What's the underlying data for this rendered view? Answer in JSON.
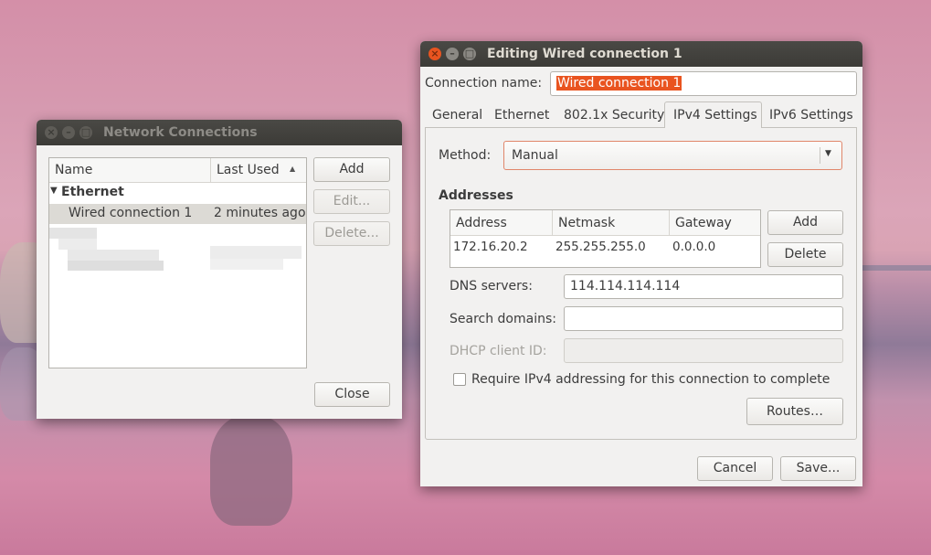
{
  "network_connections": {
    "title": "Network Connections",
    "columns": {
      "name": "Name",
      "last_used": "Last Used",
      "sort_icon": "sort-ascending-icon"
    },
    "group": {
      "label": "Ethernet",
      "icon": "expander-open-icon"
    },
    "selected_row": {
      "name": "Wired connection 1",
      "last_used": "2 minutes ago"
    },
    "buttons": {
      "add": "Add",
      "edit": "Edit...",
      "delete": "Delete...",
      "close": "Close"
    }
  },
  "editor": {
    "title": "Editing Wired connection 1",
    "connection_name_label": "Connection name:",
    "connection_name_value": "Wired connection 1",
    "tabs": [
      "General",
      "Ethernet",
      "802.1x Security",
      "IPv4 Settings",
      "IPv6 Settings"
    ],
    "active_tab": "IPv4 Settings",
    "method_label": "Method:",
    "method_value": "Manual",
    "addresses_heading": "Addresses",
    "address_columns": [
      "Address",
      "Netmask",
      "Gateway"
    ],
    "address_rows": [
      {
        "address": "172.16.20.2",
        "netmask": "255.255.255.0",
        "gateway": "0.0.0.0"
      }
    ],
    "address_buttons": {
      "add": "Add",
      "delete": "Delete"
    },
    "dns_label": "DNS servers:",
    "dns_value": "114.114.114.114",
    "search_domains_label": "Search domains:",
    "search_domains_value": "",
    "dhcp_client_id_label": "DHCP client ID:",
    "dhcp_client_id_value": "",
    "require_ipv4_label": "Require IPv4 addressing for this connection to complete",
    "require_ipv4_checked": false,
    "routes_button": "Routes…",
    "cancel_button": "Cancel",
    "save_button": "Save..."
  },
  "colors": {
    "titlebar": "#3c3b37",
    "close_button": "#e95420",
    "selection": "#e95420",
    "window_bg": "#f2f1f0"
  }
}
